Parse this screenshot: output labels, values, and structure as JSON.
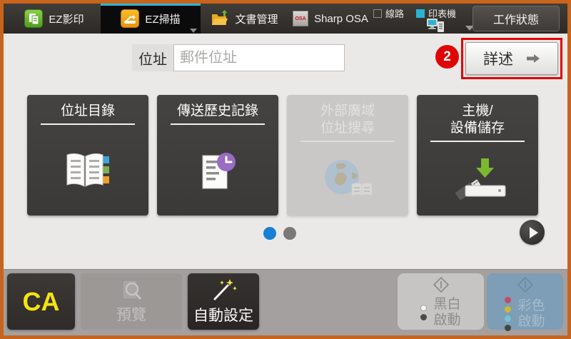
{
  "topbar": {
    "tabs": [
      {
        "label": "EZ影印"
      },
      {
        "label": "EZ掃描",
        "active": true
      },
      {
        "label": "文書管理"
      },
      {
        "label": "Sharp OSA"
      }
    ],
    "osa_icon_text": "OSA",
    "line_label": "線路",
    "printer_label": "印表機",
    "job_status_label": "工作狀態"
  },
  "address_bar": {
    "label": "位址",
    "value": "",
    "placeholder": "郵件位址"
  },
  "details_button": {
    "label": "詳述",
    "annotation_number": "2"
  },
  "tiles": [
    {
      "line1": "位址目錄",
      "line2": "",
      "icon": "address-book-icon",
      "disabled": false
    },
    {
      "line1": "傳送歷史記錄",
      "line2": "",
      "icon": "history-icon",
      "disabled": false
    },
    {
      "line1": "外部廣域",
      "line2": "位址搜尋",
      "icon": "global-address-search-icon",
      "disabled": true
    },
    {
      "line1": "主機/",
      "line2": "設備儲存",
      "icon": "usb-storage-icon",
      "disabled": false
    }
  ],
  "pagination": {
    "current_page": 1,
    "total_pages": 2
  },
  "toolbar": {
    "ca_label": "CA",
    "preview_label": "預覽",
    "auto_set_label": "自動設定",
    "bw_start": {
      "line1": "黑白",
      "line2": "啟動"
    },
    "color_start": {
      "line1": "彩色",
      "line2": "啟動"
    }
  },
  "colors": {
    "frame_border": "#c8641c",
    "active_tab_stripe": "#2bb6da",
    "printer_status_cyan": "#2ab4d0",
    "annotation_red": "#e00505",
    "pagination_active_blue": "#187fd2",
    "ca_yellow": "#f5e312",
    "color_start_bg": "#7e9db6",
    "tile_dark_bg": "#403e3d",
    "tile_disabled_bg": "#c9c8c6"
  }
}
